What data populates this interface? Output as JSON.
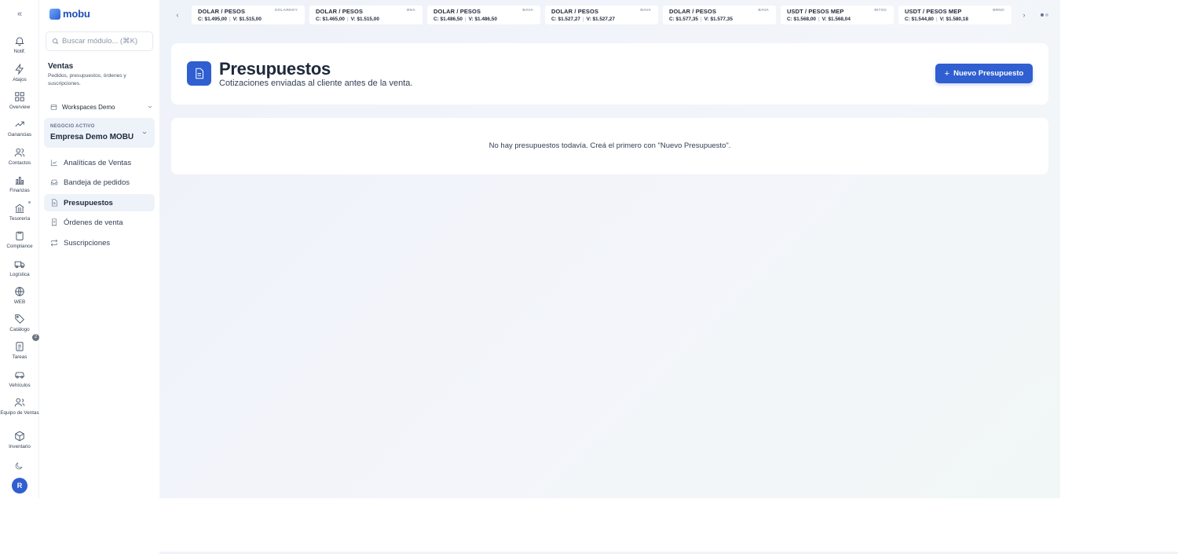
{
  "brand": {
    "name": "mobu"
  },
  "rail": [
    {
      "label": "Notif.",
      "icon": "bell-icon"
    },
    {
      "label": "Atajos",
      "icon": "zap-icon"
    },
    {
      "label": "Overview",
      "icon": "grid-icon"
    },
    {
      "label": "Ganancias",
      "icon": "trending-up-icon"
    },
    {
      "label": "Contactos",
      "icon": "users-icon"
    },
    {
      "label": "Finanzas",
      "icon": "bar-chart-icon"
    },
    {
      "label": "Tesorería",
      "icon": "bank-icon"
    },
    {
      "label": "Compliance",
      "icon": "clipboard-icon"
    },
    {
      "label": "Logística",
      "icon": "box-icon"
    },
    {
      "label": "WEB",
      "icon": "globe-icon"
    },
    {
      "label": "Catálogo",
      "icon": "tag-icon"
    },
    {
      "label": "Tareas",
      "icon": "checklist-icon"
    },
    {
      "label": "Vehículos",
      "icon": "car-icon"
    },
    {
      "label": "Equipo de Ventas",
      "icon": "team-icon"
    },
    {
      "label": "Inventario",
      "icon": "cube-icon"
    }
  ],
  "rail_badge": "2",
  "user": {
    "initial": "R"
  },
  "search": {
    "placeholder": "Buscar módulo... (⌘K)"
  },
  "module": {
    "title": "Ventas",
    "description": "Pedidos, presupuestos, órdenes y suscripciones."
  },
  "workspace": {
    "label": "Workspaces Demo"
  },
  "business": {
    "caption": "NEGOCIO ACTIVO",
    "name": "Empresa Demo MOBU"
  },
  "nav": [
    {
      "label": "Analíticas de Ventas",
      "icon": "chart-icon"
    },
    {
      "label": "Bandeja de pedidos",
      "icon": "inbox-icon"
    },
    {
      "label": "Presupuestos",
      "icon": "document-icon",
      "active": true
    },
    {
      "label": "Órdenes de venta",
      "icon": "receipt-icon"
    },
    {
      "label": "Suscripciones",
      "icon": "repeat-icon"
    }
  ],
  "rates": [
    {
      "pair": "DOLAR / PESOS",
      "source": "DOLARHOY",
      "buy": "C: $1.495,00",
      "sell": "V: $1.515,00"
    },
    {
      "pair": "DOLAR / PESOS",
      "source": "BNA",
      "buy": "C: $1.465,00",
      "sell": "V: $1.515,00"
    },
    {
      "pair": "DOLAR / PESOS",
      "source": "BAVA",
      "buy": "C: $1.486,50",
      "sell": "V: $1.486,50"
    },
    {
      "pair": "DOLAR / PESOS",
      "source": "BAVA",
      "buy": "C: $1.527,27",
      "sell": "V: $1.527,27"
    },
    {
      "pair": "DOLAR / PESOS",
      "source": "BAVA",
      "buy": "C: $1.577,35",
      "sell": "V: $1.577,35"
    },
    {
      "pair": "USDT / PESOS MEP",
      "source": "BITSO",
      "buy": "C: $1.568,00",
      "sell": "V: $1.568,04"
    },
    {
      "pair": "USDT / PESOS MEP",
      "source": "BRNO",
      "buy": "C: $1.544,80",
      "sell": "V: $1.580,18"
    }
  ],
  "page": {
    "title": "Presupuestos",
    "subtitle": "Cotizaciones enviadas al cliente antes de la venta.",
    "new_button": "Nuevo Presupuesto",
    "empty_message": "No hay presupuestos todavía. Creá el primero con \"Nuevo Presupuesto\"."
  },
  "colors": {
    "accent": "#2f5fd0",
    "active_bg": "#eef2f9"
  }
}
